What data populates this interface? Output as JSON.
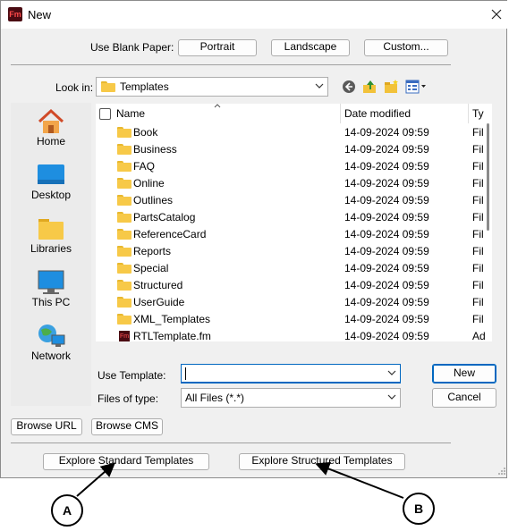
{
  "window": {
    "title": "New",
    "app_icon_text": "Fm"
  },
  "blank_paper": {
    "label": "Use Blank Paper:",
    "portrait": "Portrait",
    "landscape": "Landscape",
    "custom": "Custom..."
  },
  "look_in": {
    "label": "Look in:",
    "value": "Templates"
  },
  "places": [
    {
      "label": "Home",
      "icon": "home-icon"
    },
    {
      "label": "Desktop",
      "icon": "desktop-icon"
    },
    {
      "label": "Libraries",
      "icon": "libraries-icon"
    },
    {
      "label": "This PC",
      "icon": "this-pc-icon"
    },
    {
      "label": "Network",
      "icon": "network-icon"
    }
  ],
  "file_list": {
    "columns": [
      "Name",
      "Date modified",
      "Ty"
    ],
    "rows": [
      {
        "name": "Book",
        "date": "14-09-2024 09:59",
        "type": "Fil",
        "kind": "folder"
      },
      {
        "name": "Business",
        "date": "14-09-2024 09:59",
        "type": "Fil",
        "kind": "folder"
      },
      {
        "name": "FAQ",
        "date": "14-09-2024 09:59",
        "type": "Fil",
        "kind": "folder"
      },
      {
        "name": "Online",
        "date": "14-09-2024 09:59",
        "type": "Fil",
        "kind": "folder"
      },
      {
        "name": "Outlines",
        "date": "14-09-2024 09:59",
        "type": "Fil",
        "kind": "folder"
      },
      {
        "name": "PartsCatalog",
        "date": "14-09-2024 09:59",
        "type": "Fil",
        "kind": "folder"
      },
      {
        "name": "ReferenceCard",
        "date": "14-09-2024 09:59",
        "type": "Fil",
        "kind": "folder"
      },
      {
        "name": "Reports",
        "date": "14-09-2024 09:59",
        "type": "Fil",
        "kind": "folder"
      },
      {
        "name": "Special",
        "date": "14-09-2024 09:59",
        "type": "Fil",
        "kind": "folder"
      },
      {
        "name": "Structured",
        "date": "14-09-2024 09:59",
        "type": "Fil",
        "kind": "folder"
      },
      {
        "name": "UserGuide",
        "date": "14-09-2024 09:59",
        "type": "Fil",
        "kind": "folder"
      },
      {
        "name": "XML_Templates",
        "date": "14-09-2024 09:59",
        "type": "Fil",
        "kind": "folder"
      },
      {
        "name": "RTLTemplate.fm",
        "date": "14-09-2024 09:59",
        "type": "Ad",
        "kind": "fm-file"
      }
    ]
  },
  "use_template": {
    "label": "Use Template:",
    "value": ""
  },
  "files_of_type": {
    "label": "Files of type:",
    "value": "All Files (*.*)"
  },
  "actions": {
    "new": "New",
    "cancel": "Cancel",
    "browse_url": "Browse URL",
    "browse_cms": "Browse CMS"
  },
  "explore": {
    "standard": "Explore Standard Templates",
    "structured": "Explore Structured Templates"
  },
  "callouts": {
    "a": "A",
    "b": "B"
  }
}
